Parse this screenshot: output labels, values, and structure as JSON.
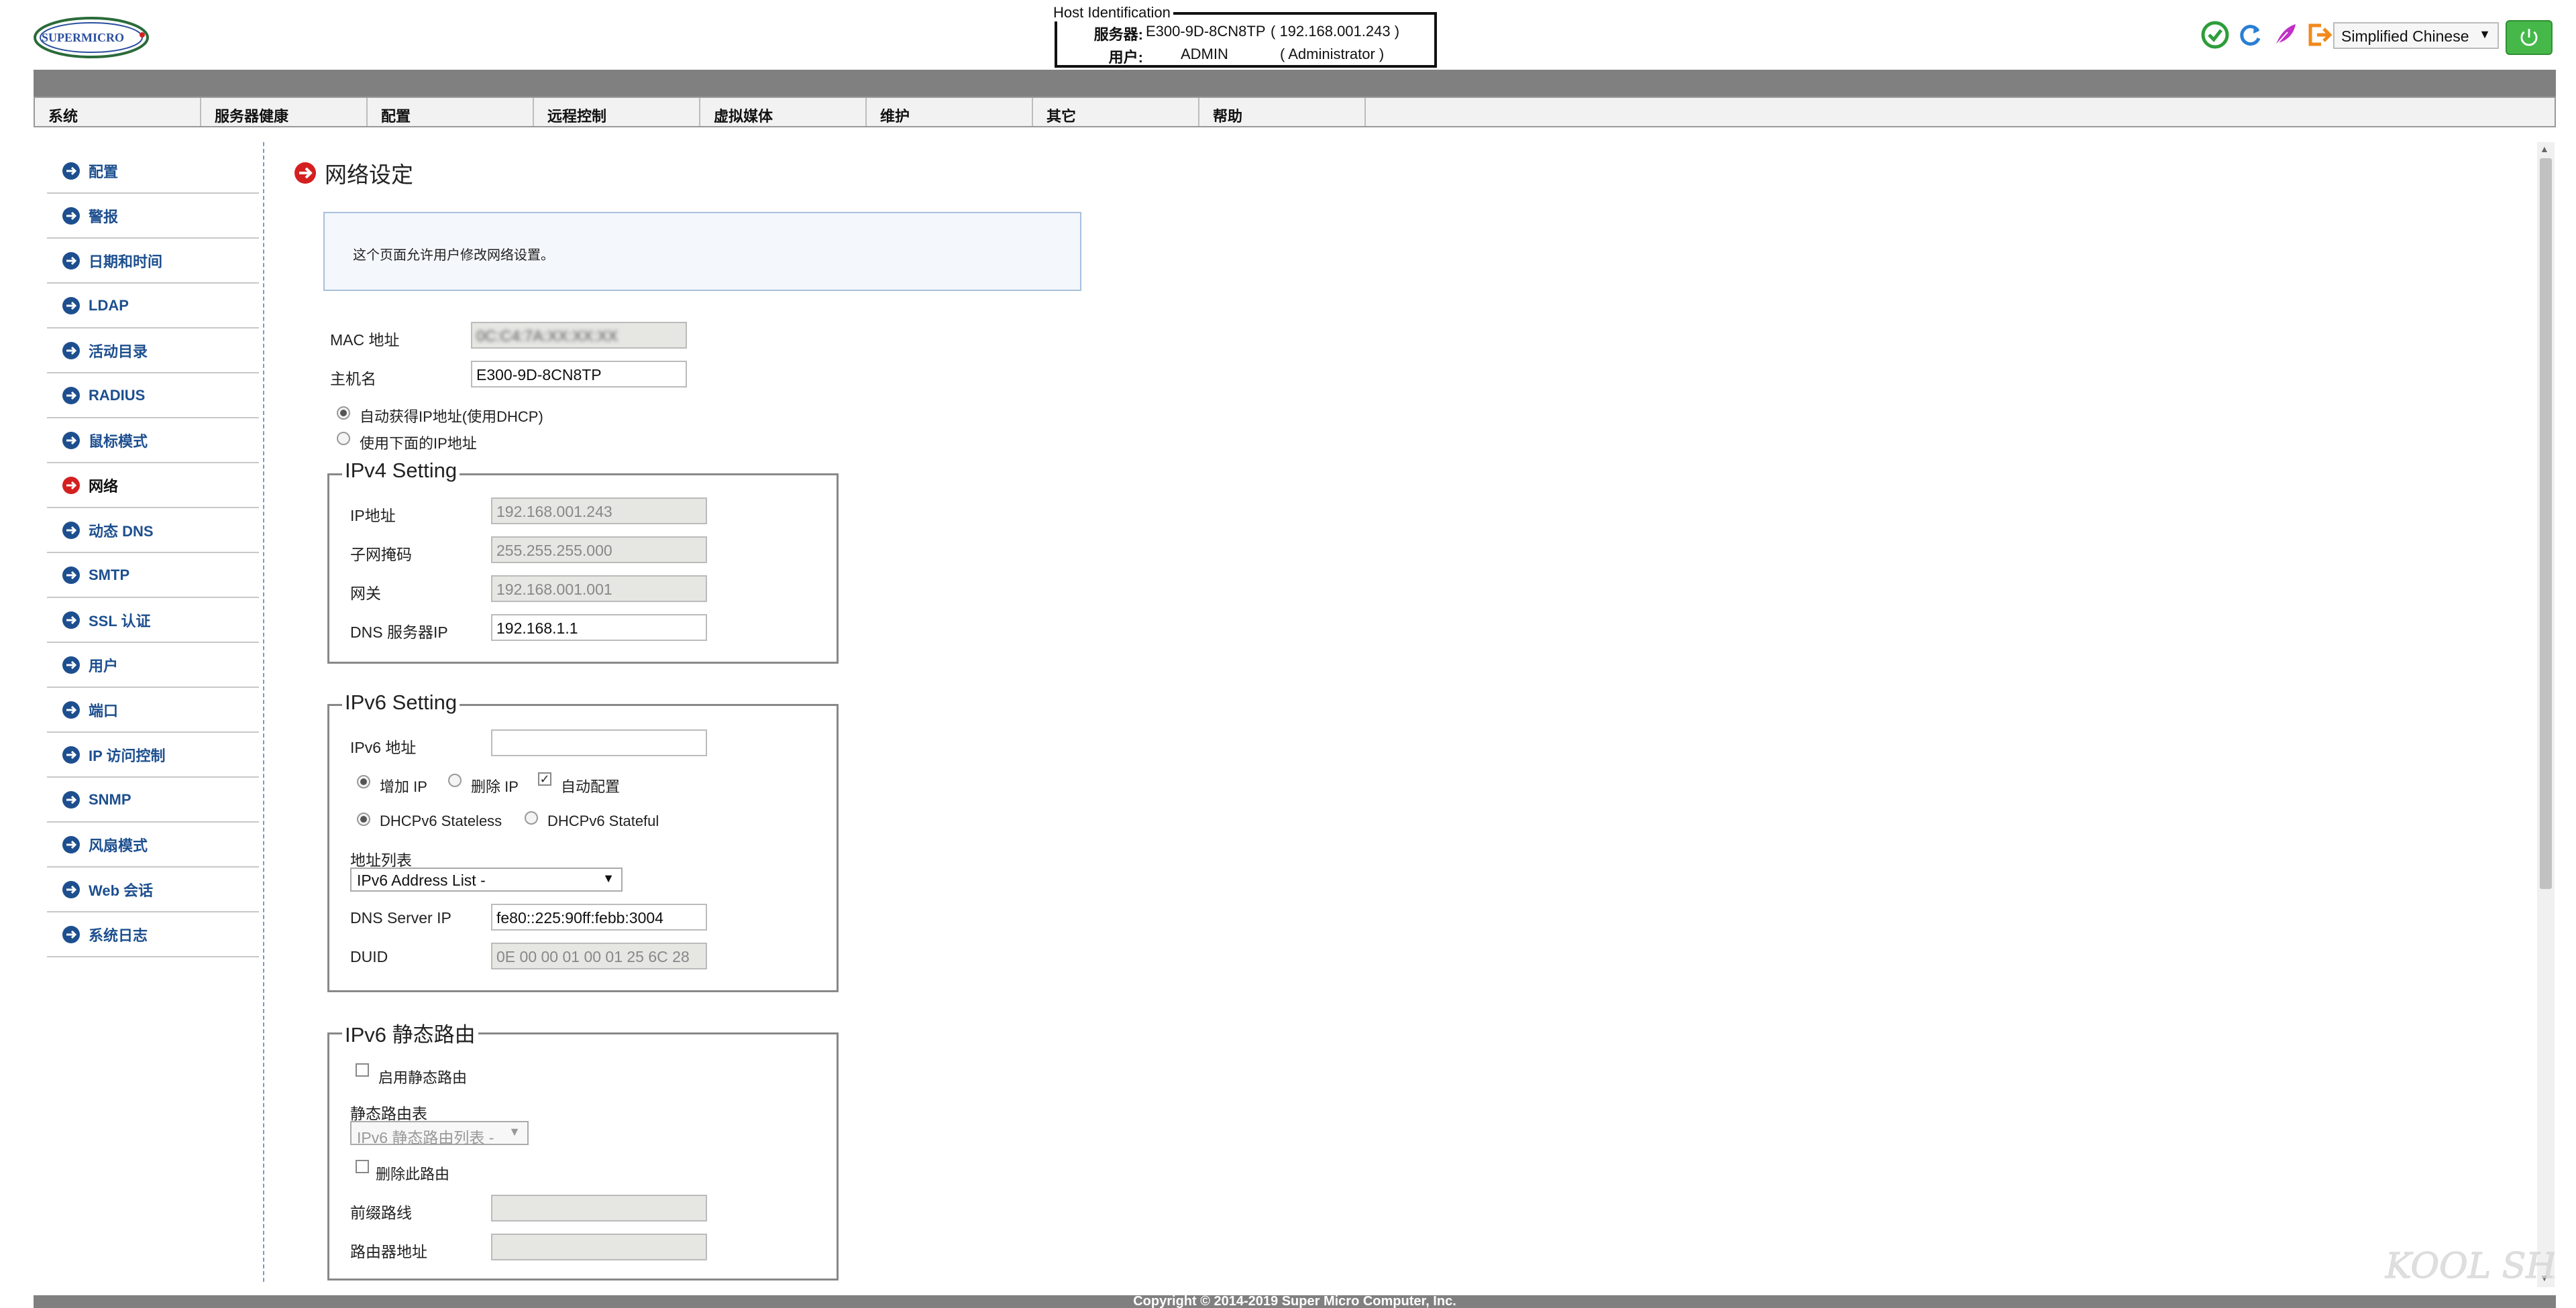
{
  "logo_text": "SUPERMICRO",
  "host": {
    "legend": "Host Identification",
    "server_label": "服务器:",
    "server_name": "E300-9D-8CN8TP",
    "server_ip": "( 192.168.001.243 )",
    "user_label": "用户:",
    "user_name": "ADMIN",
    "user_role": "( Administrator )"
  },
  "header": {
    "language": "Simplified Chinese",
    "icons": [
      "check-circle-icon",
      "refresh-icon",
      "feather-icon",
      "logout-icon",
      "power-icon"
    ]
  },
  "nav": [
    "系统",
    "服务器健康",
    "配置",
    "远程控制",
    "虚拟媒体",
    "维护",
    "其它",
    "帮助"
  ],
  "sidebar": {
    "items": [
      "配置",
      "警报",
      "日期和时间",
      "LDAP",
      "活动目录",
      "RADIUS",
      "鼠标模式",
      "网络",
      "动态 DNS",
      "SMTP",
      "SSL 认证",
      "用户",
      "端口",
      "IP 访问控制",
      "SNMP",
      "风扇模式",
      "Web 会话",
      "系统日志"
    ],
    "active_index": 7
  },
  "main": {
    "title": "网络设定",
    "info": "这个页面允许用户修改网络设置。",
    "mac_label": "MAC 地址",
    "mac_value": "0C:C4:7A:XX:XX:XX",
    "hostname_label": "主机名",
    "hostname_value": "E300-9D-8CN8TP",
    "dhcp_auto": "自动获得IP地址(使用DHCP)",
    "dhcp_manual": "使用下面的IP地址"
  },
  "ipv4": {
    "legend": "IPv4 Setting",
    "ip_label": "IP地址",
    "ip_value": "192.168.001.243",
    "mask_label": "子网掩码",
    "mask_value": "255.255.255.000",
    "gateway_label": "网关",
    "gateway_value": "192.168.001.001",
    "dns_label": "DNS 服务器IP",
    "dns_value": "192.168.1.1"
  },
  "ipv6": {
    "legend": "IPv6 Setting",
    "addr_label": "IPv6 地址",
    "addr_value": "",
    "add_ip": "增加 IP",
    "delete_ip": "删除 IP",
    "autoconfig": "自动配置",
    "stateless": "DHCPv6 Stateless",
    "stateful": "DHCPv6 Stateful",
    "list_label": "地址列表",
    "list_value": "IPv6 Address List -",
    "dns_label": "DNS Server IP",
    "dns_value": "fe80::225:90ff:febb:3004",
    "duid_label": "DUID",
    "duid_value": "0E 00 00 01 00 01 25 6C 28"
  },
  "ipv6_static": {
    "legend": "IPv6 静态路由",
    "enable": "启用静态路由",
    "table_label": "静态路由表",
    "table_value": "IPv6 静态路由列表 -",
    "delete_route": "删除此路由",
    "prefix_label": "前缀路线",
    "router_label": "路由器地址"
  },
  "footer": "Copyright © 2014-2019 Super Micro Computer, Inc.",
  "watermark": "KOOL SHARE",
  "colors": {
    "nav_bar": "#808080",
    "link_blue": "#1d4f8f",
    "active_red": "#d42020",
    "power_green": "#46b84a"
  }
}
